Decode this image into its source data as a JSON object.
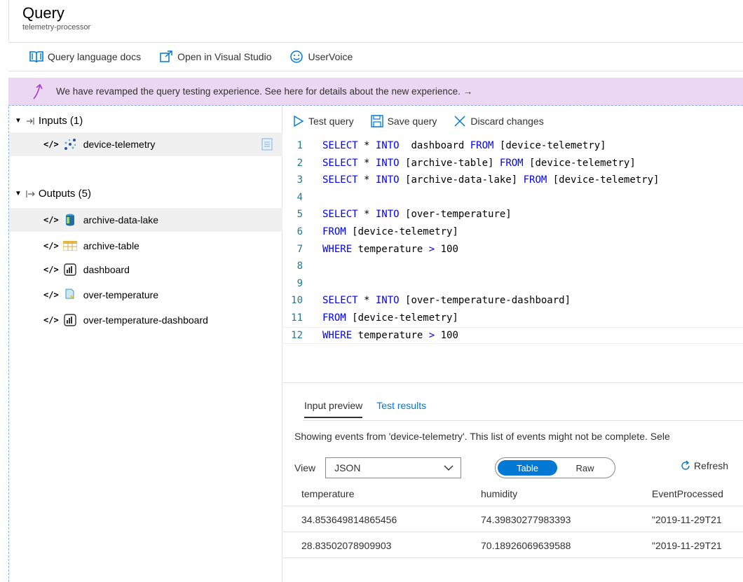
{
  "header": {
    "title": "Query",
    "subtitle": "telemetry-processor"
  },
  "commandbar": {
    "docs": "Query language docs",
    "visual_studio": "Open in Visual Studio",
    "uservoice": "UserVoice"
  },
  "banner": {
    "text": "We have revamped the query testing experience. See here for details about the new experience. →"
  },
  "tree": {
    "inputs_label": "Inputs (1)",
    "inputs": [
      {
        "label": "device-telemetry",
        "icon": "event-hub-icon"
      }
    ],
    "outputs_label": "Outputs (5)",
    "outputs": [
      {
        "label": "archive-data-lake",
        "icon": "data-lake-icon"
      },
      {
        "label": "archive-table",
        "icon": "table-storage-icon"
      },
      {
        "label": "dashboard",
        "icon": "power-bi-icon"
      },
      {
        "label": "over-temperature",
        "icon": "function-icon"
      },
      {
        "label": "over-temperature-dashboard",
        "icon": "power-bi-icon"
      }
    ],
    "code_glyph": "</>"
  },
  "editor_toolbar": {
    "test": "Test query",
    "save": "Save query",
    "discard": "Discard changes"
  },
  "editor": {
    "lines": [
      {
        "n": "1",
        "parts": [
          [
            "kw",
            "SELECT"
          ],
          [
            "tx",
            " * "
          ],
          [
            "kw",
            "INTO"
          ],
          [
            "tx",
            "  dashboard "
          ],
          [
            "kw",
            "FROM"
          ],
          [
            "tx",
            " [device-telemetry]"
          ]
        ]
      },
      {
        "n": "2",
        "parts": [
          [
            "kw",
            "SELECT"
          ],
          [
            "tx",
            " * "
          ],
          [
            "kw",
            "INTO"
          ],
          [
            "tx",
            " [archive-table] "
          ],
          [
            "kw",
            "FROM"
          ],
          [
            "tx",
            " [device-telemetry]"
          ]
        ]
      },
      {
        "n": "3",
        "parts": [
          [
            "kw",
            "SELECT"
          ],
          [
            "tx",
            " * "
          ],
          [
            "kw",
            "INTO"
          ],
          [
            "tx",
            " [archive-data-lake] "
          ],
          [
            "kw",
            "FROM"
          ],
          [
            "tx",
            " [device-telemetry]"
          ]
        ]
      },
      {
        "n": "4",
        "parts": []
      },
      {
        "n": "5",
        "parts": [
          [
            "kw",
            "SELECT"
          ],
          [
            "tx",
            " * "
          ],
          [
            "kw",
            "INTO"
          ],
          [
            "tx",
            " [over-temperature]"
          ]
        ]
      },
      {
        "n": "6",
        "parts": [
          [
            "kw",
            "FROM"
          ],
          [
            "tx",
            " [device-telemetry]"
          ]
        ]
      },
      {
        "n": "7",
        "parts": [
          [
            "kw",
            "WHERE"
          ],
          [
            "tx",
            " temperature "
          ],
          [
            "kw",
            ">"
          ],
          [
            "tx",
            " 100"
          ]
        ]
      },
      {
        "n": "8",
        "parts": []
      },
      {
        "n": "9",
        "parts": []
      },
      {
        "n": "10",
        "parts": [
          [
            "kw",
            "SELECT"
          ],
          [
            "tx",
            " * "
          ],
          [
            "kw",
            "INTO"
          ],
          [
            "tx",
            " [over-temperature-dashboard]"
          ]
        ]
      },
      {
        "n": "11",
        "parts": [
          [
            "kw",
            "FROM"
          ],
          [
            "tx",
            " [device-telemetry]"
          ]
        ]
      },
      {
        "n": "12",
        "parts": [
          [
            "kw",
            "WHERE"
          ],
          [
            "tx",
            " temperature "
          ],
          [
            "kw",
            ">"
          ],
          [
            "tx",
            " 100"
          ]
        ]
      }
    ]
  },
  "results": {
    "tab_input": "Input preview",
    "tab_test": "Test results",
    "info": "Showing events from 'device-telemetry'. This list of events might not be complete. Sele",
    "view_label": "View",
    "view_value": "JSON",
    "toggle_on": "Table",
    "toggle_off": "Raw",
    "refresh": "Refresh",
    "columns": [
      "temperature",
      "humidity",
      "EventProcessed"
    ],
    "rows": [
      [
        "34.853649814865456",
        "74.39830277983393",
        "\"2019-11-29T21"
      ],
      [
        "28.83502078909903",
        "70.18926069639588",
        "\"2019-11-29T21"
      ]
    ]
  },
  "colors": {
    "accent": "#0078d4",
    "banner_bg": "#ecd7f3",
    "keyword": "#0000ff",
    "line_number": "#237893"
  }
}
